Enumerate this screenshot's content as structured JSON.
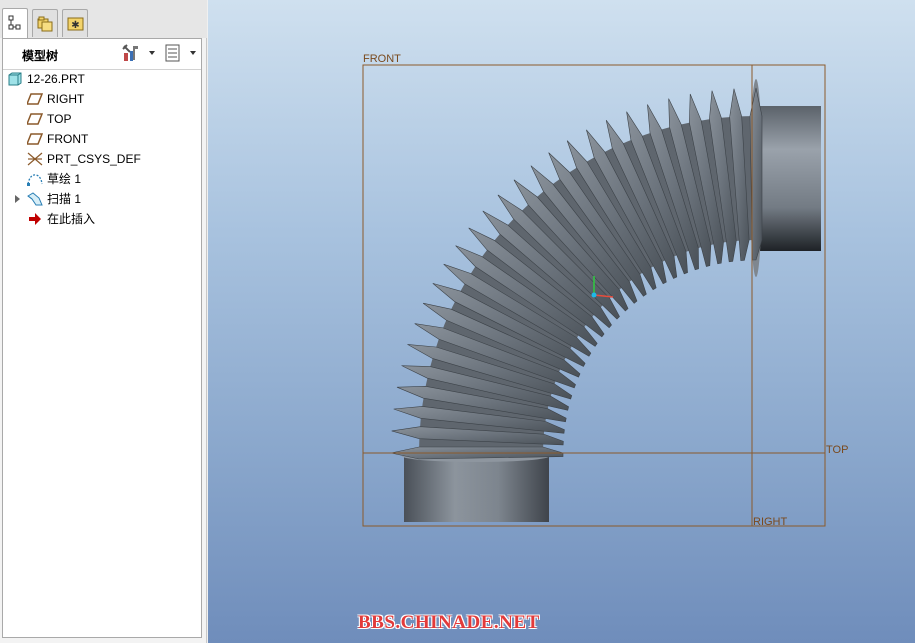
{
  "model_tree": {
    "title": "模型树",
    "root": "12-26.PRT",
    "items": [
      {
        "label": "RIGHT",
        "icon": "datum-plane-icon"
      },
      {
        "label": "TOP",
        "icon": "datum-plane-icon"
      },
      {
        "label": "FRONT",
        "icon": "datum-plane-icon"
      },
      {
        "label": "PRT_CSYS_DEF",
        "icon": "coordinate-system-icon"
      },
      {
        "label": "草绘 1",
        "icon": "sketch-icon"
      },
      {
        "label": "扫描 1",
        "icon": "sweep-feature-icon",
        "expandable": true
      },
      {
        "label": "在此插入",
        "icon": "insert-here-arrow-icon"
      }
    ]
  },
  "tabs": [
    {
      "icon": "model-tree-tab-icon",
      "active": true
    },
    {
      "icon": "folder-browser-tab-icon",
      "active": false
    },
    {
      "icon": "favorites-tab-icon",
      "active": false
    }
  ],
  "viewport": {
    "plane_labels": {
      "front": "FRONT",
      "top": "TOP",
      "right": "RIGHT"
    },
    "watermark": "BBS.CHINADE.NET"
  },
  "colors": {
    "datum_plane": "#8b5a2b",
    "watermark": "#e23b3b",
    "part_surface": "#6e7680",
    "insert_arrow": "#c00000"
  }
}
